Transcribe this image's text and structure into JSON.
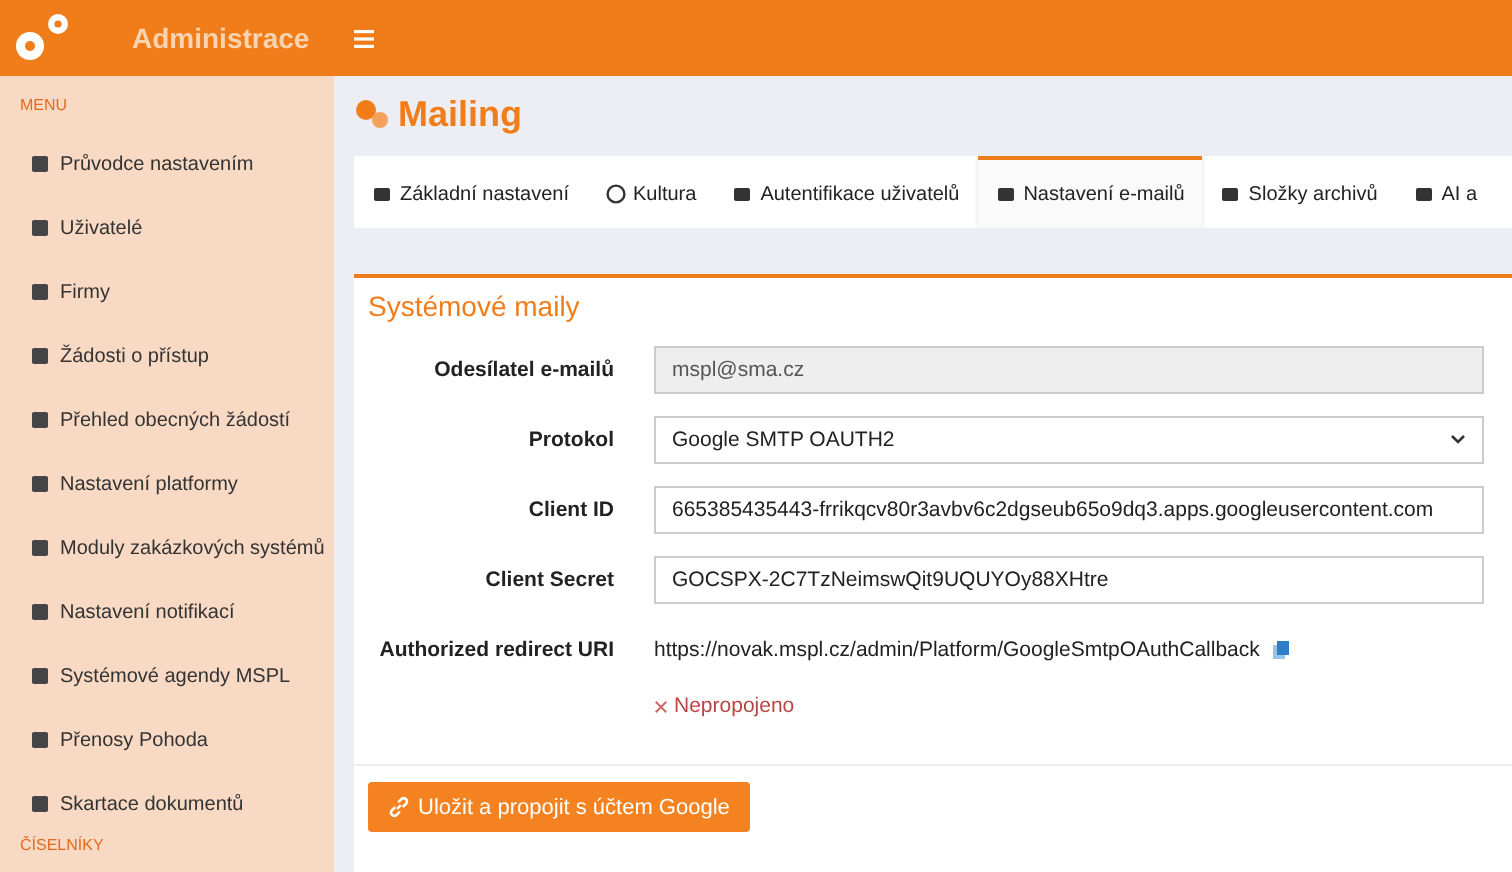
{
  "brand": {
    "title": "Administrace"
  },
  "sidebar": {
    "sections": [
      {
        "heading": "MENU",
        "items": [
          {
            "label": "Průvodce nastavením"
          },
          {
            "label": "Uživatelé"
          },
          {
            "label": "Firmy"
          },
          {
            "label": "Žádosti o přístup"
          },
          {
            "label": "Přehled obecných žádostí"
          },
          {
            "label": "Nastavení platformy"
          },
          {
            "label": "Moduly zakázkových systémů"
          },
          {
            "label": "Nastavení notifikací"
          },
          {
            "label": "Systémové agendy MSPL"
          },
          {
            "label": "Přenosy Pohoda"
          },
          {
            "label": "Skartace dokumentů"
          }
        ]
      },
      {
        "heading": "ČÍSELNÍKY"
      }
    ]
  },
  "page": {
    "title": "Mailing"
  },
  "tabs": [
    {
      "label": "Základní nastavení",
      "selected": false
    },
    {
      "label": "Kultura",
      "selected": false
    },
    {
      "label": "Autentifikace uživatelů",
      "selected": false
    },
    {
      "label": "Nastavení e-mailů",
      "selected": true
    },
    {
      "label": "Složky archivů",
      "selected": false
    },
    {
      "label": "AI a",
      "selected": false
    }
  ],
  "card": {
    "title": "Systémové maily",
    "rows": [
      {
        "kind": "text",
        "label": "Odesílatel e-mailů",
        "value": "mspl@sma.cz",
        "disabled": true
      },
      {
        "kind": "select",
        "label": "Protokol",
        "value": "Google SMTP OAUTH2",
        "disabled": false
      },
      {
        "kind": "text",
        "label": "Client ID",
        "value": "665385435443-frrikqcv80r3avbv6c2dgseub65o9dq3.apps.googleusercontent.com",
        "disabled": false
      },
      {
        "kind": "text",
        "label": "Client Secret",
        "value": "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",
        "disabled": false
      },
      {
        "kind": "link",
        "label": "Authorized redirect URI",
        "value": "https://novak.mspl.cz/admin/Platform/GoogleSmtpOAuthCallback"
      }
    ],
    "status": {
      "label": "Nepropojeno",
      "connected": false
    },
    "button": "Uložit a propojit s účtem Google"
  }
}
